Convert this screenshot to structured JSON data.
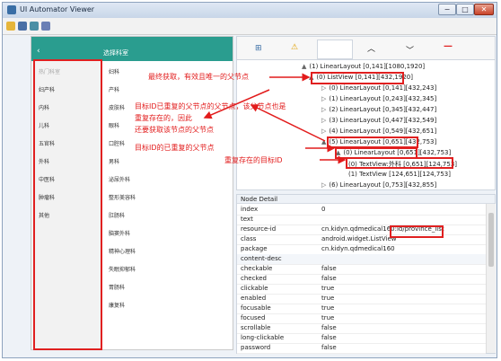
{
  "window": {
    "title": "UI Automator Viewer",
    "minimize_label": "−",
    "maximize_label": "□",
    "close_label": "✕"
  },
  "toolbar": {
    "icons": [
      "open-icon",
      "device-screenshot-icon",
      "compressed-screenshot-icon",
      "save-icon"
    ]
  },
  "device": {
    "back_icon": "‹",
    "screen_title": "选择科室",
    "categories": [
      "热门科室",
      "妇产科",
      "内科",
      "儿科",
      "五官科",
      "外科",
      "中医科",
      "肿瘤科",
      "其他"
    ],
    "hospitals": [
      "妇科",
      "产科",
      "皮肤科",
      "眼科",
      "口腔科",
      "男科",
      "泌尿外科",
      "整形美容科",
      "肛肠科",
      "脑窦外科",
      "精神心理科",
      "失眠抑郁科",
      "胃肠科",
      "康复科"
    ]
  },
  "tree_toolbar": {
    "expand_icon": "⊞",
    "warning_icon": "⚠",
    "up_icon": "︿",
    "down_icon": "﹀",
    "collapse_icon": "—"
  },
  "tree": {
    "nodes": [
      "(1) LinearLayout [0,141][1080,1920]",
      "(0) ListView [0,141][432,1920]",
      "(0) LinearLayout [0,141][432,243]",
      "(1) LinearLayout [0,243][432,345]",
      "(2) LinearLayout [0,345][432,447]",
      "(3) LinearLayout [0,447][432,549]",
      "(4) LinearLayout [0,549][432,651]",
      "(5) LinearLayout [0,651][432,753]",
      "(0) LinearLayout [0,651][432,753]",
      "(0) TextView:外科 [0,651][124,753]",
      "(1) TextView [124,651][124,753]",
      "(6) LinearLayout [0,753][432,855]"
    ]
  },
  "detail": {
    "header": "Node Detail",
    "rows": [
      {
        "key": "index",
        "value": "0"
      },
      {
        "key": "text",
        "value": ""
      },
      {
        "key": "resource-id",
        "value": "cn.kidyn.qdmedical160:id/province_list"
      },
      {
        "key": "class",
        "value": "android.widget.ListView"
      },
      {
        "key": "package",
        "value": "cn.kidyn.qdmedical160"
      },
      {
        "key": "content-desc",
        "value": ""
      },
      {
        "key": "checkable",
        "value": "false"
      },
      {
        "key": "checked",
        "value": "false"
      },
      {
        "key": "clickable",
        "value": "true"
      },
      {
        "key": "enabled",
        "value": "true"
      },
      {
        "key": "focusable",
        "value": "true"
      },
      {
        "key": "focused",
        "value": "true"
      },
      {
        "key": "scrollable",
        "value": "false"
      },
      {
        "key": "long-clickable",
        "value": "false"
      },
      {
        "key": "password",
        "value": "false"
      }
    ]
  },
  "annotations": {
    "final_parent": "最终获取，有效且唯一的父节点",
    "repeated_parent_1": "目标ID已重复的父节点的父节点，该父节点也是",
    "repeated_parent_2": "重复存在的，因此",
    "repeated_parent_3": "还要获取该节点的父节点",
    "repeated_parent_target": "目标ID的已重复的父节点",
    "repeated_target": "重复存在的目标ID"
  },
  "colors": {
    "accent": "#2a9d8f",
    "annotation": "#e21b1b",
    "window_border": "#8ea3bd"
  }
}
